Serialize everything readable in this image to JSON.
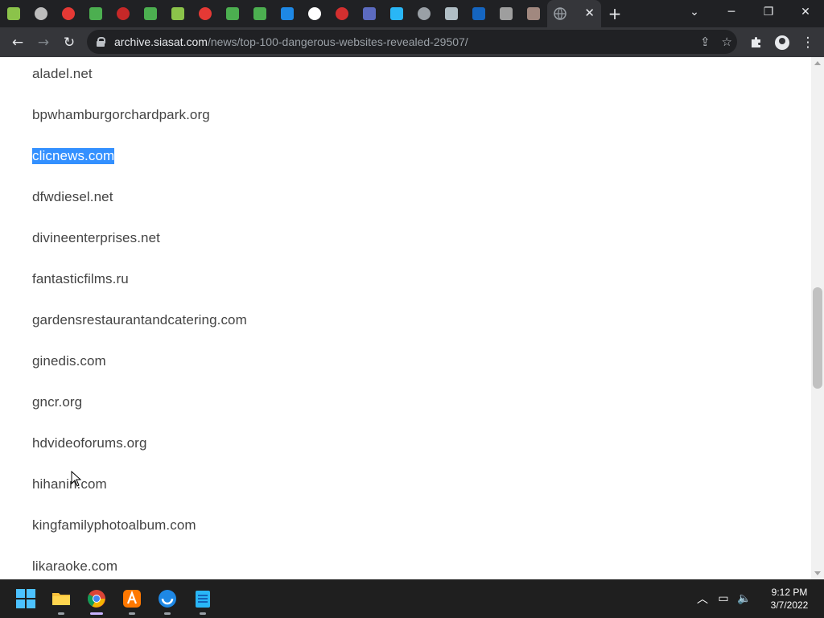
{
  "browser": {
    "tabs": [
      {
        "icon": "green-book-icon",
        "color": "#8bc34a"
      },
      {
        "icon": "globe-face-icon",
        "color": "#bdbdbd"
      },
      {
        "icon": "pinwheel-icon",
        "color": "#e53935"
      },
      {
        "icon": "shield-emblem-icon",
        "color": "#4caf50"
      },
      {
        "icon": "red-circle-icon",
        "color": "#c62828"
      },
      {
        "icon": "download-icon",
        "color": "#4caf50"
      },
      {
        "icon": "green-book-icon",
        "color": "#8bc34a"
      },
      {
        "icon": "pinwheel-icon",
        "color": "#e53935"
      },
      {
        "icon": "download-icon",
        "color": "#4caf50"
      },
      {
        "icon": "download-icon",
        "color": "#4caf50"
      },
      {
        "icon": "steam-icon",
        "color": "#1e88e5"
      },
      {
        "icon": "google-icon",
        "color": "#ffffff"
      },
      {
        "icon": "devil-face-icon",
        "color": "#d32f2f"
      },
      {
        "icon": "edit-note-icon",
        "color": "#5c6bc0"
      },
      {
        "icon": "blue-fish-icon",
        "color": "#29b6f6"
      },
      {
        "icon": "globe-icon",
        "color": "#9aa0a6"
      },
      {
        "icon": "chef-icon",
        "color": "#b0bec5"
      },
      {
        "icon": "blue-bag-icon",
        "color": "#1565c0"
      },
      {
        "icon": "grey-tile-icon",
        "color": "#9e9e9e"
      },
      {
        "icon": "person-photo-icon",
        "color": "#a1887f"
      }
    ],
    "active_tab": {
      "icon": "globe-icon",
      "close": "✕"
    },
    "url_host": "archive.siasat.com",
    "url_path": "/news/top-100-dangerous-websites-revealed-29507/"
  },
  "page": {
    "sites": [
      {
        "label": "aladel.net",
        "selected": false
      },
      {
        "label": "bpwhamburgorchardpark.org",
        "selected": false
      },
      {
        "label": "clicnews.com",
        "selected": true
      },
      {
        "label": "dfwdiesel.net",
        "selected": false
      },
      {
        "label": "divineenterprises.net",
        "selected": false
      },
      {
        "label": "fantasticfilms.ru",
        "selected": false
      },
      {
        "label": "gardensrestaurantandcatering.com",
        "selected": false
      },
      {
        "label": "ginedis.com",
        "selected": false
      },
      {
        "label": "gncr.org",
        "selected": false
      },
      {
        "label": "hdvideoforums.org",
        "selected": false
      },
      {
        "label": "hihanin.com",
        "selected": false
      },
      {
        "label": "kingfamilyphotoalbum.com",
        "selected": false
      },
      {
        "label": "likaraoke.com",
        "selected": false
      }
    ]
  },
  "taskbar": {
    "apps": [
      {
        "icon": "windows-start-icon"
      },
      {
        "icon": "file-explorer-icon"
      },
      {
        "icon": "chrome-icon",
        "active": true
      },
      {
        "icon": "avast-icon"
      },
      {
        "icon": "blue-app-icon"
      },
      {
        "icon": "notepad-icon"
      }
    ],
    "time": "9:12 PM",
    "date": "3/7/2022"
  }
}
